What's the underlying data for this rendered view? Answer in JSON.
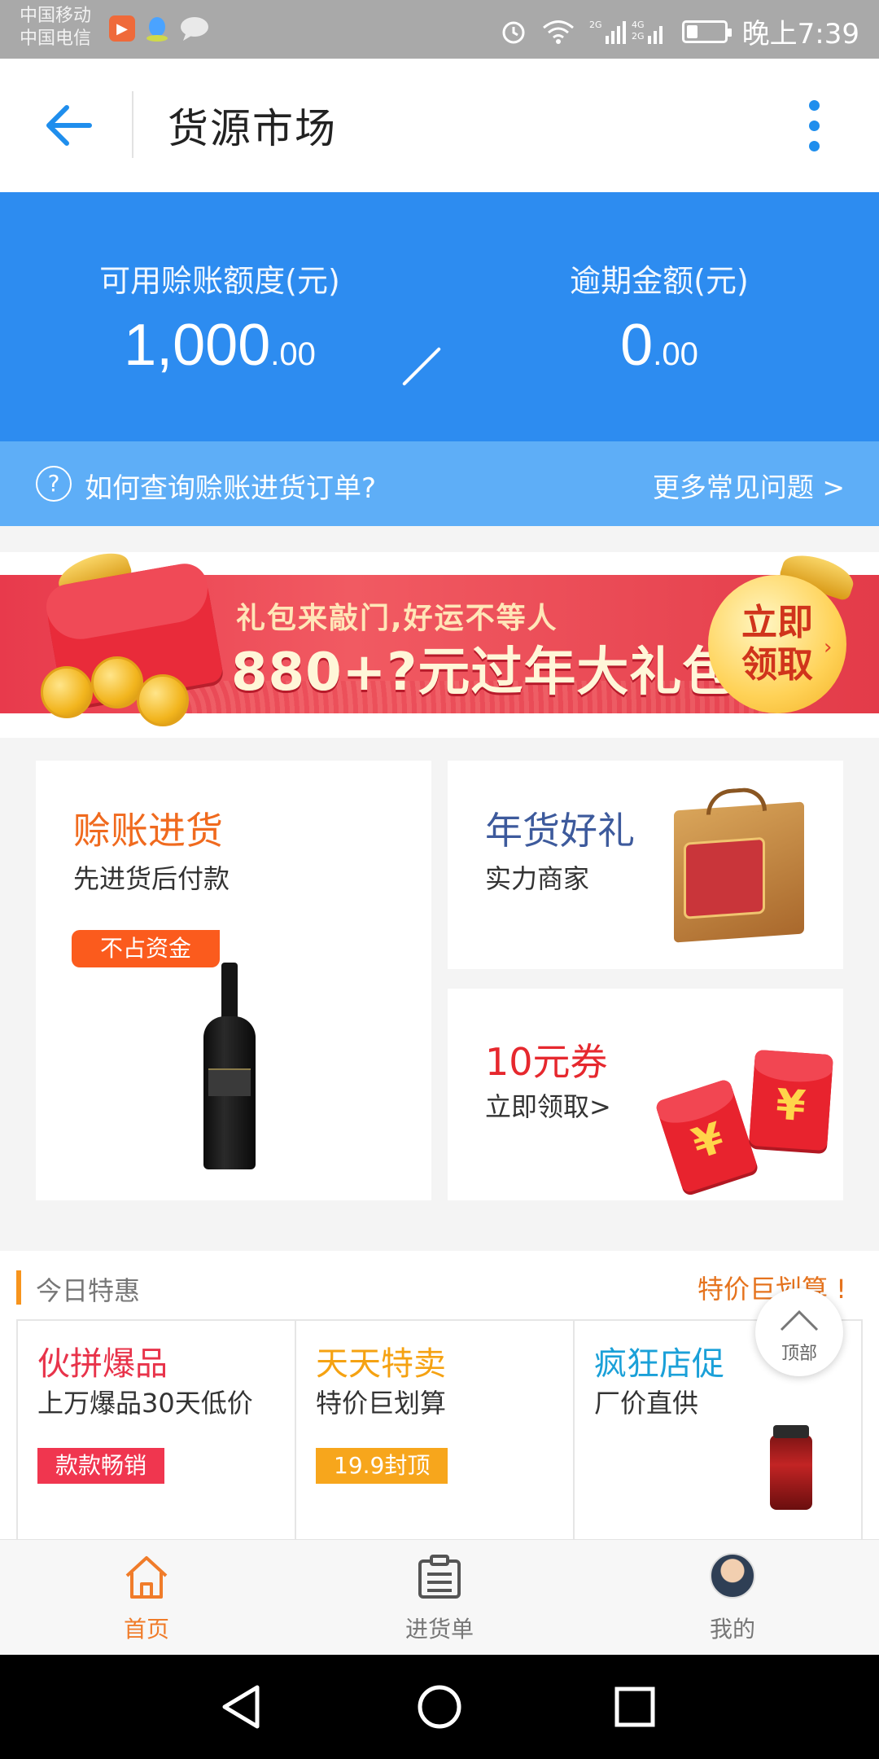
{
  "status_bar": {
    "carrier1": "中国移动",
    "carrier2": "中国电信",
    "time": "晚上7:39",
    "battery_level": 0.3,
    "icons": [
      "video-app-icon",
      "penguin-icon",
      "chat-icon",
      "alarm-icon",
      "wifi-icon",
      "signal-icon",
      "battery-icon"
    ]
  },
  "header": {
    "title": "货源市场",
    "accent_color": "#1f8eed"
  },
  "credit": {
    "available_label": "可用赊账额度(元)",
    "available_int": "1,000",
    "available_dec": ".00",
    "overdue_label": "逾期金额(元)",
    "overdue_int": "0",
    "overdue_dec": ".00",
    "bg_color": "#2d8cf0"
  },
  "faq": {
    "question": "如何查询赊账进货订单?",
    "more": "更多常见问题 >"
  },
  "banner": {
    "subtitle": "礼包来敲门,好运不等人",
    "main": "880+?元过年大礼包",
    "claim_line1": "立即",
    "claim_line2": "领取"
  },
  "promo": {
    "credit_buy": {
      "title": "赊账进货",
      "subtitle": "先进货后付款",
      "tag": "不占资金",
      "title_color": "#f06a1e"
    },
    "new_year_gift": {
      "title": "年货好礼",
      "subtitle": "实力商家",
      "title_color": "#3d5a9c"
    },
    "coupon": {
      "title": "10元券",
      "subtitle": "立即领取>",
      "title_color": "#e6282e"
    }
  },
  "deals": {
    "title": "今日特惠",
    "slogan": "特价巨划算 !",
    "items": [
      {
        "title": "伙拼爆品",
        "subtitle": "上万爆品30天低价",
        "tag": "款款畅销",
        "title_color": "#e8334a",
        "tag_color": "#f0364f"
      },
      {
        "title": "天天特卖",
        "subtitle": "特价巨划算",
        "tag": "19.9封顶",
        "title_color": "#f5a212",
        "tag_color": "#f7a61c"
      },
      {
        "title": "疯狂店促",
        "subtitle": "厂价直供",
        "tag": "",
        "title_color": "#1aa0d8",
        "tag_color": ""
      }
    ]
  },
  "top_button": {
    "label": "顶部"
  },
  "tabbar": {
    "tabs": [
      {
        "label": "首页",
        "active": true
      },
      {
        "label": "进货单",
        "active": false
      },
      {
        "label": "我的",
        "active": false
      }
    ],
    "active_color": "#f07c2a",
    "inactive_color": "#777777"
  }
}
